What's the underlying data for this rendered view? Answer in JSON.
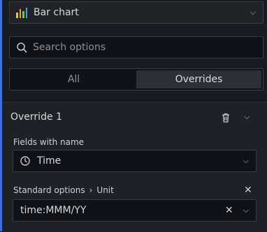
{
  "visualization_picker": {
    "label": "Bar chart",
    "icon": "bar-chart-icon",
    "icon_colors": [
      "#f2cc0c",
      "#ff9830",
      "#73bf69",
      "#5794f2"
    ]
  },
  "search": {
    "placeholder": "Search options",
    "value": ""
  },
  "tabs": [
    {
      "label": "All",
      "active": false
    },
    {
      "label": "Overrides",
      "active": true
    }
  ],
  "override": {
    "title": "Override 1",
    "matcher": {
      "label": "Fields with name",
      "value": "Time"
    },
    "property": {
      "category": "Standard options",
      "separator": "›",
      "name": "Unit",
      "value": "time:MMM/YY"
    }
  },
  "colors": {
    "accent_edge": "#3d71d9",
    "panel_bg": "#181b1f",
    "override_bg": "#1e2125"
  }
}
